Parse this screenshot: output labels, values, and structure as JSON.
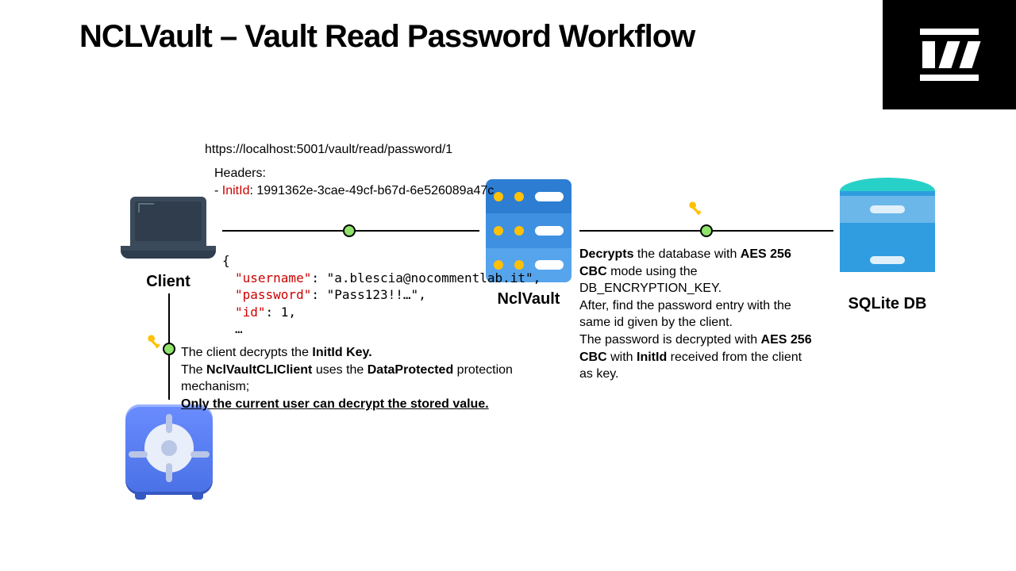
{
  "title": "NCLVault – Vault Read Password Workflow",
  "labels": {
    "client": "Client",
    "nclvault": "NclVault",
    "sqlite": "SQLite DB"
  },
  "request": {
    "url": "https://localhost:5001/vault/read/password/1",
    "headers_label": "Headers:",
    "header_name": "InitId",
    "header_value": "1991362e-3cae-49cf-b67d-6e526089a47c"
  },
  "response": {
    "open": "{",
    "k_user": "\"username\"",
    "v_user": ": \"a.blescia@nocommentlab.it\",",
    "k_pass": "\"password\"",
    "v_pass": ": \"Pass123!!…\",",
    "k_id": "\"id\"",
    "v_id": ": 1,",
    "ellipsis": "…"
  },
  "client_desc": {
    "line1a": "The client decrypts the ",
    "line1b": "InitId Key.",
    "line2a": "The ",
    "line2b": "NclVaultCLIClient",
    "line2c": " uses the ",
    "line2d": "DataProtected",
    "line2e": " protection mechanism;",
    "line3": "Only the current user can decrypt the stored value."
  },
  "server_desc": {
    "l1a": "Decrypts",
    "l1b": " the database with ",
    "l1c": "AES 256 CBC",
    "l2": " mode using the DB_ENCRYPTION_KEY.",
    "l3": "After, find the password entry with the same id given by the client.",
    "l4a": "The password is decrypted with ",
    "l4b": "AES 256 CBC",
    "l4c": " with ",
    "l4d": "InitId",
    "l4e": " received from the client as key."
  }
}
